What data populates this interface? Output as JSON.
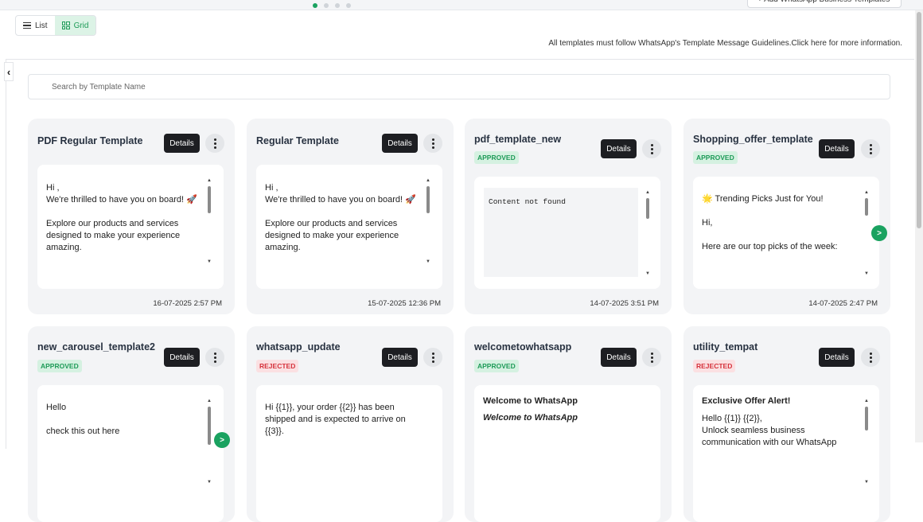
{
  "header": {
    "add_button_label": "+ Add WhatsApp Business Templates"
  },
  "view_toggle": {
    "list_label": "List",
    "grid_label": "Grid",
    "active": "Grid"
  },
  "guideline_text": "All templates must follow WhatsApp's Template Message Guidelines.Click here for more information.",
  "search": {
    "placeholder": "Search by Template Name"
  },
  "colors": {
    "accent": "#1aa260",
    "approved_bg": "#d5f1e1",
    "rejected_bg": "#fbe0e2"
  },
  "cards": [
    {
      "title": "PDF Regular Template",
      "status": "",
      "details_label": "Details",
      "preview": "Hi ,\nWe're thrilled to have you on board! 🚀\n\nExplore our products and services designed to make your experience amazing.",
      "date": "16-07-2025 2:57 PM"
    },
    {
      "title": "Regular Template",
      "status": "",
      "details_label": "Details",
      "preview": "Hi ,\nWe're thrilled to have you on board! 🚀\n\nExplore our products and services designed to make your experience amazing.",
      "date": "15-07-2025 12:36 PM"
    },
    {
      "title": "pdf_template_new",
      "status": "APPROVED",
      "details_label": "Details",
      "preview": "Content not found",
      "date": "14-07-2025 3:51 PM"
    },
    {
      "title": "Shopping_offer_template",
      "status": "APPROVED",
      "details_label": "Details",
      "preview": "🌟 Trending Picks Just for You!\n\nHi,\n\nHere are our top picks of the week:",
      "date": "14-07-2025 2:47 PM",
      "next_label": ">"
    },
    {
      "title": "new_carousel_template2",
      "status": "APPROVED",
      "details_label": "Details",
      "preview": "Hello\n\ncheck this out here",
      "next_label": ">"
    },
    {
      "title": "whatsapp_update",
      "status": "REJECTED",
      "details_label": "Details",
      "preview": "Hi {{1}}, your order {{2}} has been shipped and is expected to arrive on {{3}}."
    },
    {
      "title": "welcometowhatsapp",
      "status": "APPROVED",
      "details_label": "Details",
      "preview_heading": "Welcome to WhatsApp",
      "preview_italic": "Welcome to WhatsApp"
    },
    {
      "title": "utility_tempat",
      "status": "REJECTED",
      "details_label": "Details",
      "preview_heading": "Exclusive Offer Alert!",
      "preview": "Hello {{1}} {{2}},\nUnlock seamless business communication with our WhatsApp"
    }
  ]
}
